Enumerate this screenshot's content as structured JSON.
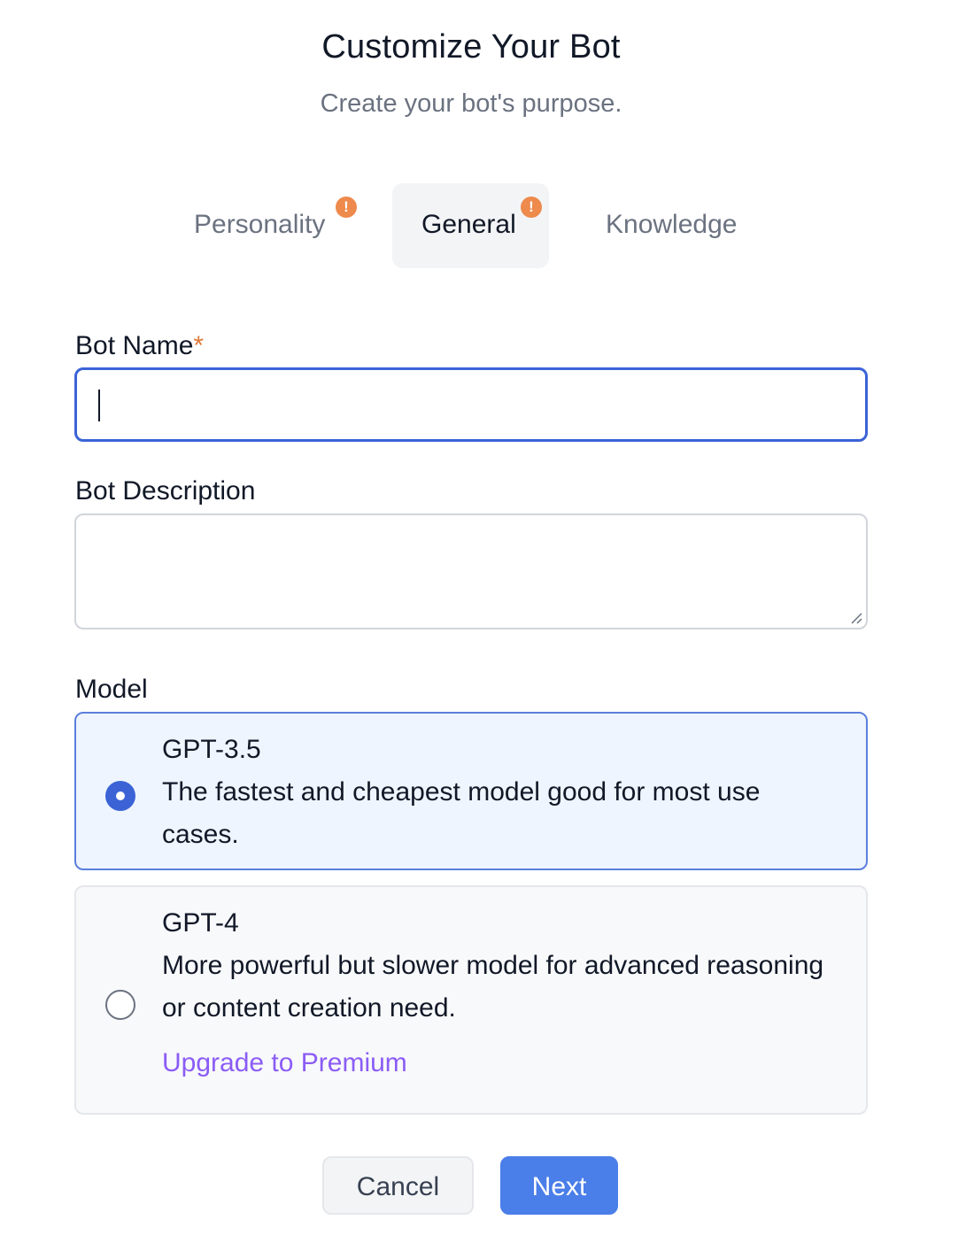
{
  "header": {
    "title": "Customize Your Bot",
    "subtitle": "Create your bot's purpose."
  },
  "tabs": [
    {
      "label": "Personality",
      "warning": true,
      "badge": "!"
    },
    {
      "label": "General",
      "warning": true,
      "badge": "!",
      "active": true
    },
    {
      "label": "Knowledge",
      "warning": false
    }
  ],
  "form": {
    "bot_name": {
      "label": "Bot Name",
      "required_marker": "*",
      "value": ""
    },
    "bot_description": {
      "label": "Bot Description",
      "value": ""
    },
    "model": {
      "label": "Model",
      "options": [
        {
          "name": "GPT-3.5",
          "description": "The fastest and cheapest model good for most use cases.",
          "selected": true
        },
        {
          "name": "GPT-4",
          "description": "More powerful but slower model for advanced reasoning or content creation need.",
          "link": "Upgrade to Premium",
          "selected": false
        }
      ]
    }
  },
  "actions": {
    "cancel_label": "Cancel",
    "next_label": "Next"
  },
  "colors": {
    "accent": "#3b63d6",
    "primary_button": "#4a7ee8",
    "warning_badge": "#ed8a4c",
    "premium_link": "#8b5cf6",
    "selected_card_bg": "#eef5fe"
  }
}
